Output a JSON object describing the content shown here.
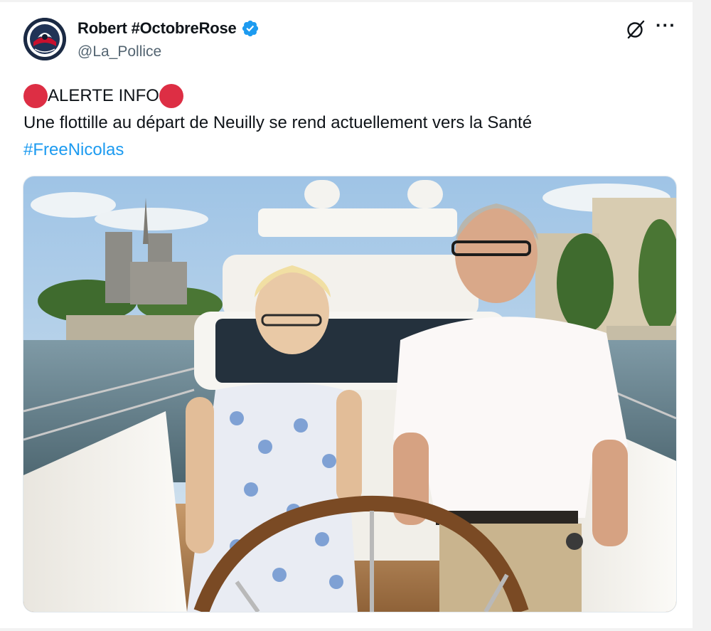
{
  "author": {
    "display_name": "Robert #OctobreRose",
    "handle": "@La_Pollice",
    "avatar_icon": "police-badge-avatar-icon",
    "verified_icon": "verified-badge-icon",
    "verified_color": "#1d9bf0"
  },
  "header_actions": {
    "grok_icon": "grok-icon",
    "more_icon": "more-icon",
    "more_label": "···"
  },
  "post": {
    "alert_label": "ALERTE INFO",
    "alert_emoji": "red-circle-icon",
    "body": "Une flottille au départ de Neuilly se rend actuellement vers la Santé",
    "hashtag": "#FreeNicolas",
    "hashtag_color": "#1d9bf0"
  },
  "media": {
    "kind": "photo",
    "subject": "elderly-couple-steering-yacht-on-seine-photo"
  }
}
